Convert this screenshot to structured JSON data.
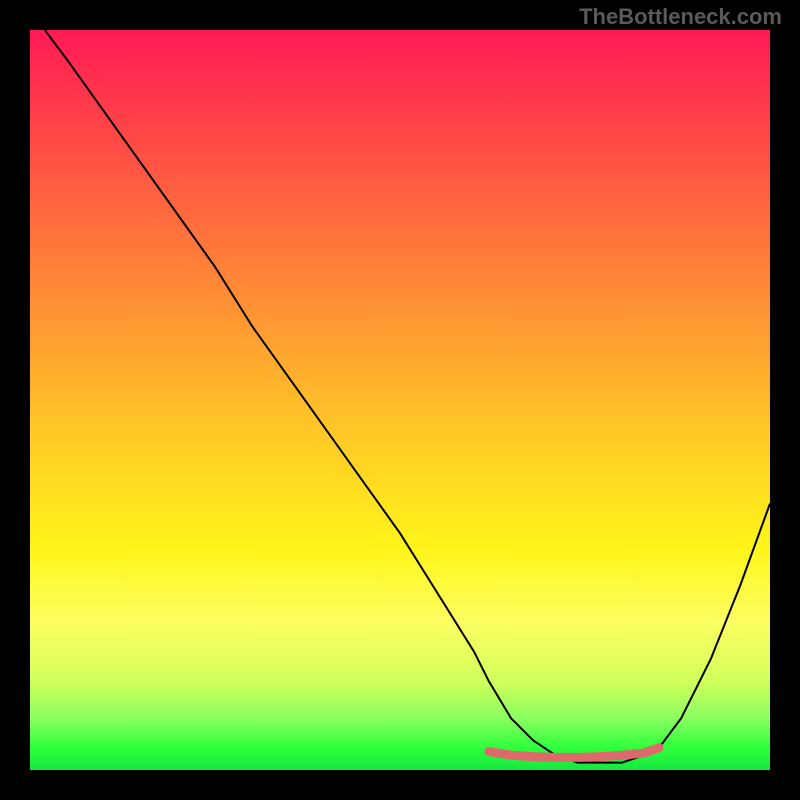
{
  "watermark": "TheBottleneck.com",
  "chart_data": {
    "type": "line",
    "title": "",
    "xlabel": "",
    "ylabel": "",
    "xlim": [
      0,
      100
    ],
    "ylim": [
      0,
      100
    ],
    "series": [
      {
        "name": "bottleneck-curve",
        "x": [
          2,
          5,
          10,
          15,
          20,
          25,
          30,
          35,
          40,
          45,
          50,
          55,
          60,
          62,
          65,
          68,
          71,
          74,
          77,
          80,
          83,
          85,
          88,
          92,
          96,
          100
        ],
        "y": [
          100,
          96,
          89,
          82,
          75,
          68,
          60,
          53,
          46,
          39,
          32,
          24,
          16,
          12,
          7,
          4,
          2,
          1,
          1,
          1,
          2,
          3,
          7,
          15,
          25,
          36
        ]
      },
      {
        "name": "optimal-range-marker",
        "x": [
          62,
          65,
          68,
          71,
          74,
          77,
          80,
          83,
          85
        ],
        "y": [
          2.5,
          2,
          1.8,
          1.7,
          1.7,
          1.8,
          2,
          2.3,
          3
        ],
        "color": "#dd6a6a"
      }
    ],
    "gradient_stops": [
      {
        "pct": 0,
        "color": "#ff1a55"
      },
      {
        "pct": 50,
        "color": "#ffca26"
      },
      {
        "pct": 80,
        "color": "#feff62"
      },
      {
        "pct": 100,
        "color": "#15e83e"
      }
    ]
  }
}
